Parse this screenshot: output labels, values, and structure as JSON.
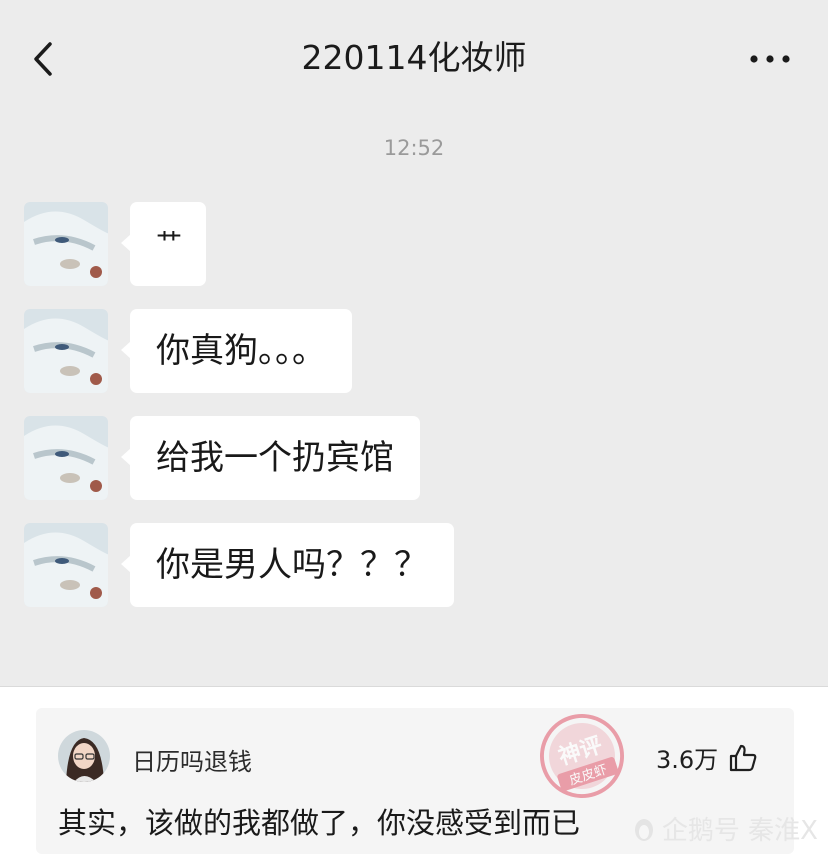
{
  "header": {
    "title": "220114化妆师",
    "back_icon": "chevron-left-icon",
    "more_icon": "more-dots-icon"
  },
  "chat": {
    "timestamp": "12:52",
    "messages": [
      {
        "text": "艹"
      },
      {
        "text": "你真狗。。。"
      },
      {
        "text": "给我一个扔宾馆"
      },
      {
        "text": "你是男人吗？？？"
      }
    ]
  },
  "comment": {
    "username": "日历吗退钱",
    "likes": "3.6万",
    "like_icon": "thumbs-up-icon",
    "text": "其实，该做的我都做了，你没感受到而已",
    "stamp_text_top": "神评",
    "stamp_text_bottom": "皮皮虾",
    "source_watermark": "企鹅号 秦淮X"
  },
  "colors": {
    "chat_bg": "#ececec",
    "bubble": "#ffffff",
    "stamp": "#e0566a"
  }
}
